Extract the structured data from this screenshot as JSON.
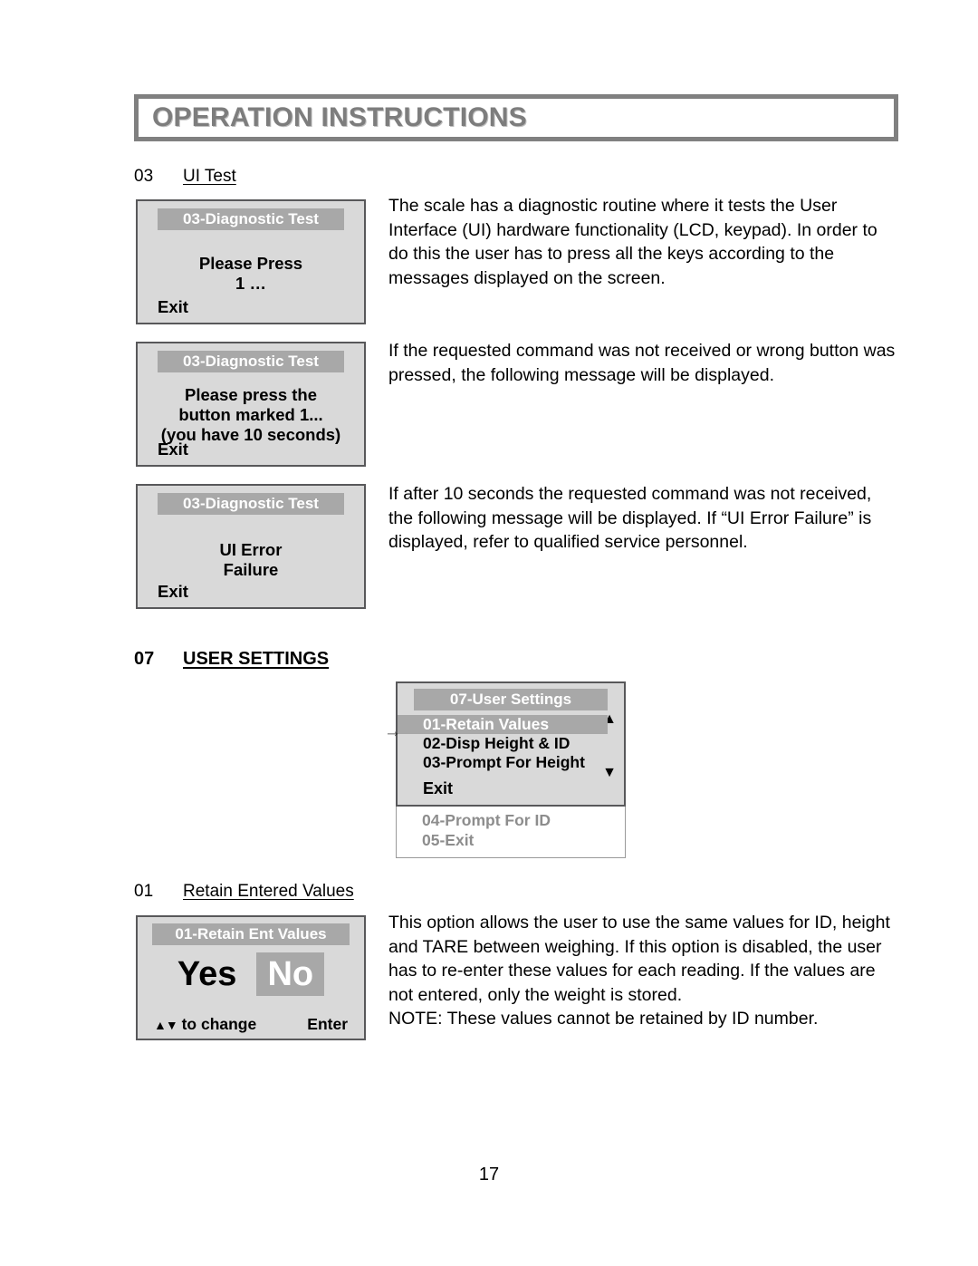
{
  "header": {
    "title": "OPERATION INSTRUCTIONS"
  },
  "sections": {
    "ui_test": {
      "number": "03",
      "label": "UI Test"
    },
    "user_settings": {
      "number": "07",
      "label": "USER SETTINGS"
    },
    "retain_entered_values": {
      "number": "01",
      "label": "Retain Entered Values"
    }
  },
  "paragraphs": {
    "diagnostic_intro": "The scale has a diagnostic routine where it tests the User Interface (UI) hardware functionality (LCD, keypad). In order to do this the user has to press all the keys according to the messages displayed on the screen.",
    "wrong_button": "If the requested command was not received or wrong button was pressed, the following message will be displayed.",
    "timeout": "If after 10 seconds the requested command was not received, the following message will be displayed. If “UI Error Failure” is displayed, refer to qualified service personnel.",
    "retain_values": "This option allows the user to use the same values for ID, height and TARE between weighing. If this option is disabled, the user has to re-enter these values for each reading. If the values are not entered, only the weight is stored.\nNOTE: These values cannot be retained by ID number."
  },
  "lcd_panels": {
    "press_key": {
      "title": "03-Diagnostic Test",
      "line1": "Please Press",
      "line2": "1 …",
      "exit": "Exit"
    },
    "timed_prompt": {
      "title": "03-Diagnostic Test",
      "line1": "Please press the",
      "line2": "button marked 1...",
      "line3": "(you have 10 seconds)",
      "exit": "Exit"
    },
    "ui_error": {
      "title": "03-Diagnostic Test",
      "line1": "UI Error",
      "line2": "Failure",
      "exit": "Exit"
    },
    "user_settings_menu": {
      "title": "07-User Settings",
      "cursor": "→",
      "scroll_up": "▲",
      "scroll_down": "▼",
      "items": [
        {
          "label": "01-Retain Values",
          "selected": true
        },
        {
          "label": "02-Disp Height & ID",
          "selected": false
        },
        {
          "label": "03-Prompt For Height",
          "selected": false
        }
      ],
      "exit": "Exit",
      "overflow_items": [
        "04-Prompt For ID",
        "05-Exit"
      ]
    },
    "retain_ent_values": {
      "title": "01-Retain Ent Values",
      "option_yes": "Yes",
      "option_no": "No",
      "selected_option": "No",
      "hint_arrows": "▲▼",
      "hint_text": " to change",
      "enter": "Enter"
    }
  },
  "footer": {
    "page_number": "17"
  },
  "colors": {
    "lcd_background": "#d9d9d9",
    "lcd_titlebar": "#a8a8a8",
    "lcd_border": "#58585a",
    "header_text": "#7d7d7d",
    "disabled_text": "#8d8d8d"
  }
}
